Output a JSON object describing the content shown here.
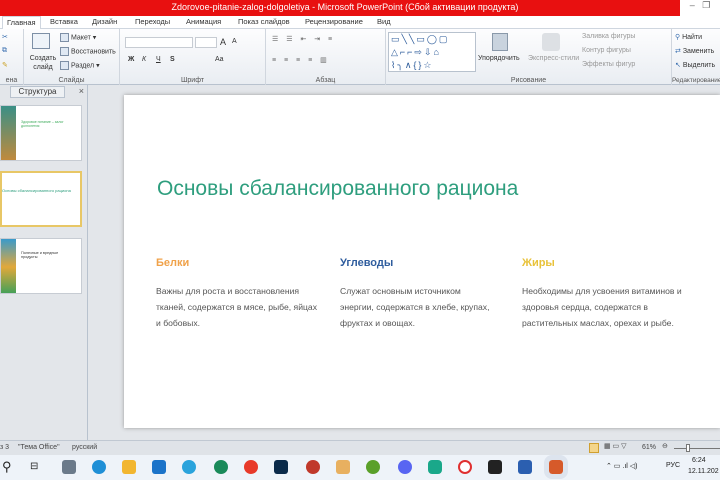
{
  "window": {
    "title": "Zdorovoe-pitanie-zalog-dolgoletiya - Microsoft PowerPoint (Сбой активации продукта)",
    "minimize": "–",
    "restore": "❐"
  },
  "tabs": [
    "Главная",
    "Вставка",
    "Дизайн",
    "Переходы",
    "Анимация",
    "Показ слайдов",
    "Рецензирование",
    "Вид"
  ],
  "ribbon": {
    "slides": {
      "new_slide": "Создать слайд",
      "layout": "Макет",
      "reset": "Восстановить",
      "section": "Раздел",
      "label": "Слайды"
    },
    "font": {
      "label": "Шрифт",
      "bold": "Ж",
      "italic": "К",
      "underline": "Ч",
      "strike": "S",
      "grow": "A",
      "shrink": "A",
      "case": "Aa"
    },
    "paragraph": {
      "label": "Абзац"
    },
    "drawing": {
      "arrange": "Упорядочить",
      "quick_styles": "Экспресс-стили",
      "fill": "Заливка фигуры",
      "outline": "Контур фигуры",
      "effects": "Эффекты фигур",
      "label": "Рисование",
      "shapes": "▭╲╲▭◯▢ △⌐⌐⇨⇩⌂ ⌇╮∧{}☆"
    },
    "editing": {
      "find": "Найти",
      "replace": "Заменить",
      "select": "Выделить",
      "label": "Редактирование"
    },
    "clipboard_label": "ена"
  },
  "panel": {
    "tab": "Структура",
    "close": "×",
    "thumbs": [
      {
        "title": "Здоровое питание – залог долголетия"
      },
      {
        "title": "Основы сбалансированного рациона"
      },
      {
        "title": "Полезные и вредные продукты"
      }
    ]
  },
  "slide": {
    "title": "Основы сбалансированного рациона",
    "columns": [
      {
        "heading": "Белки",
        "color": "#f0a24a",
        "text": "Важны для роста и восстановления тканей, содержатся в мясе, рыбе, яйцах и бобовых."
      },
      {
        "heading": "Углеводы",
        "color": "#2f5d9e",
        "text": "Служат основным источником энергии, содержатся в хлебе, крупах, фруктах и овощах."
      },
      {
        "heading": "Жиры",
        "color": "#e8c23a",
        "text": "Необходимы  для усвоения витаминов и здоровья  сердца, содержатся в растительных маслах, орехах и рыбе."
      }
    ]
  },
  "status": {
    "slide": "з 3",
    "theme": "\"Тема Office\"",
    "language": "русский",
    "zoom": "61%"
  },
  "taskbar": {
    "lang": "РУС",
    "time": "6:24",
    "date": "12.11.202"
  }
}
